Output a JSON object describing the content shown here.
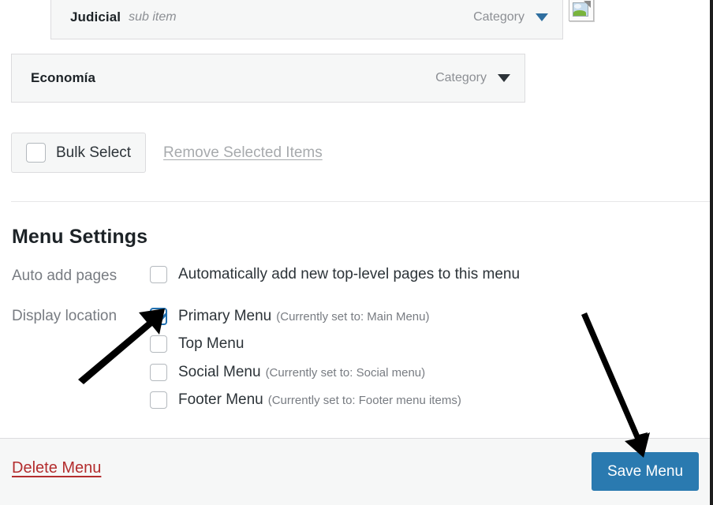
{
  "menu_items": [
    {
      "title": "Judicial",
      "sub_label": "sub item",
      "type": "Category",
      "icon": "broken-image-icon",
      "is_sub": true
    },
    {
      "title": "Economía",
      "sub_label": "",
      "type": "Category",
      "icon": "chevron-down-icon",
      "is_sub": false
    }
  ],
  "bulk": {
    "select_label": "Bulk Select",
    "remove_label": "Remove Selected Items",
    "checked": false
  },
  "settings": {
    "heading": "Menu Settings",
    "auto_add": {
      "label": "Auto add pages",
      "option_label": "Automatically add new top-level pages to this menu",
      "checked": false
    },
    "display_location": {
      "label": "Display location",
      "options": [
        {
          "name": "Primary Menu",
          "note": "(Currently set to: Main Menu)",
          "checked": true
        },
        {
          "name": "Top Menu",
          "note": "",
          "checked": false
        },
        {
          "name": "Social Menu",
          "note": "(Currently set to: Social menu)",
          "checked": false
        },
        {
          "name": "Footer Menu",
          "note": "(Currently set to: Footer menu items)",
          "checked": false
        }
      ]
    }
  },
  "footer": {
    "delete_label": "Delete Menu",
    "save_label": "Save Menu"
  },
  "colors": {
    "accent_blue": "#2271b1",
    "button_blue": "#2a7ab0",
    "delete_red": "#b32d2e",
    "muted_text": "#787c82",
    "row_bg": "#f6f7f7",
    "border": "#dcdcde",
    "annotation": "#000000"
  }
}
